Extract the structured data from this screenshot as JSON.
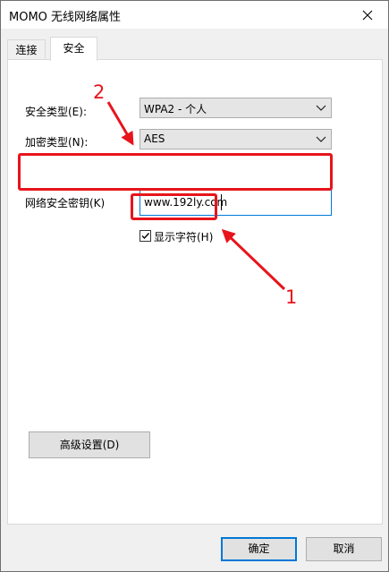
{
  "window": {
    "title": "MOMO 无线网络属性"
  },
  "tabs": [
    {
      "label": "连接"
    },
    {
      "label": "安全"
    }
  ],
  "security": {
    "type_label": "安全类型(E):",
    "type_value": "WPA2 - 个人",
    "encryption_label": "加密类型(N):",
    "encryption_value": "AES",
    "key_label": "网络安全密钥(K)",
    "key_value": "www.192ly.com",
    "show_chars_label": "显示字符(H)",
    "show_chars_checked": true,
    "advanced_button": "高级设置(D)"
  },
  "footer": {
    "ok": "确定",
    "cancel": "取消"
  },
  "annotations": {
    "marker_1": "1",
    "marker_2": "2",
    "color": "#e8141b"
  },
  "icons": {
    "close": "close-icon",
    "dropdown": "chevron-down-icon",
    "check": "check-icon"
  }
}
